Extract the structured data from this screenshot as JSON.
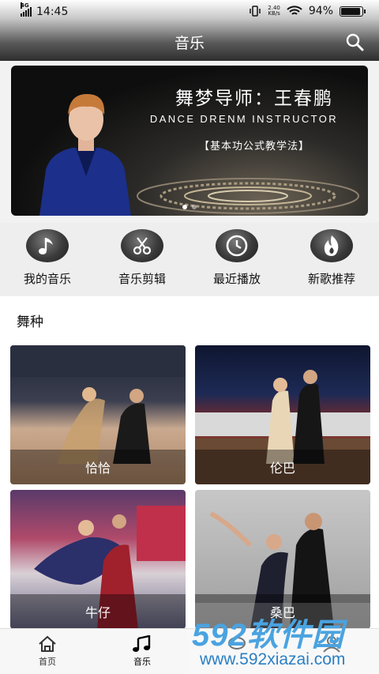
{
  "status_bar": {
    "network": "4G",
    "time": "14:45",
    "net_speed_value": "2.40",
    "net_speed_unit": "KB/s",
    "battery_percent": "94%",
    "battery_level": 0.94
  },
  "app_bar": {
    "title": "音乐",
    "search_icon": "search-icon"
  },
  "banner": {
    "title": "舞梦导师：王春鹏",
    "subtitle": "DANCE DRENM INSTRUCTOR",
    "method": "【基本功公式教学法】",
    "slide_count": 2,
    "active_slide": 1
  },
  "quick_menu": [
    {
      "label": "我的音乐",
      "icon": "music-note-icon"
    },
    {
      "label": "音乐剪辑",
      "icon": "scissors-icon"
    },
    {
      "label": "最近播放",
      "icon": "clock-icon"
    },
    {
      "label": "新歌推荐",
      "icon": "flame-icon"
    }
  ],
  "dance_section": {
    "heading": "舞种",
    "cards": [
      {
        "label": "恰恰"
      },
      {
        "label": "伦巴"
      },
      {
        "label": "牛仔"
      },
      {
        "label": "桑巴"
      }
    ]
  },
  "bottom_nav": [
    {
      "label": "首页",
      "icon": "home-icon",
      "active": false
    },
    {
      "label": "音乐",
      "icon": "music-notes-icon",
      "active": true
    },
    {
      "label": "",
      "icon": "chat-icon",
      "active": false
    },
    {
      "label": "",
      "icon": "user-icon",
      "active": false
    }
  ],
  "watermark": {
    "brand": "592软件园",
    "url": "www.592xiazai.com"
  }
}
